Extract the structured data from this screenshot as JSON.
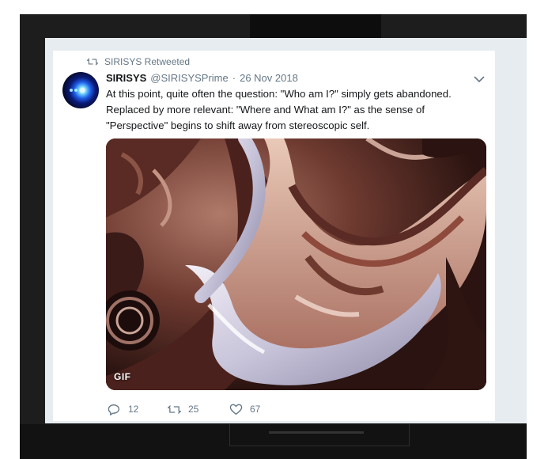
{
  "retweet_banner": {
    "label": "SIRISYS Retweeted"
  },
  "tweet": {
    "display_name": "SIRISYS",
    "handle": "@SIRISYSPrime",
    "separator": "·",
    "date": "26 Nov 2018",
    "text_lines": [
      "At this point, quite often the question: \"Who am I?\" simply gets abandoned.",
      "Replaced by more relevant: \"Where and What am I?\" as the sense of",
      "\"Perspective\" begins to shift away from stereoscopic self."
    ],
    "media": {
      "badge": "GIF"
    },
    "actions": {
      "replies": "12",
      "retweets": "25",
      "likes": "67"
    }
  },
  "icons": {
    "retweet": "retweet-icon",
    "reply": "reply-icon",
    "like": "heart-icon",
    "menu": "chevron-down-icon"
  },
  "colors": {
    "text_primary": "#14171a",
    "text_secondary": "#657786",
    "page_background": "#e6ecf0"
  }
}
